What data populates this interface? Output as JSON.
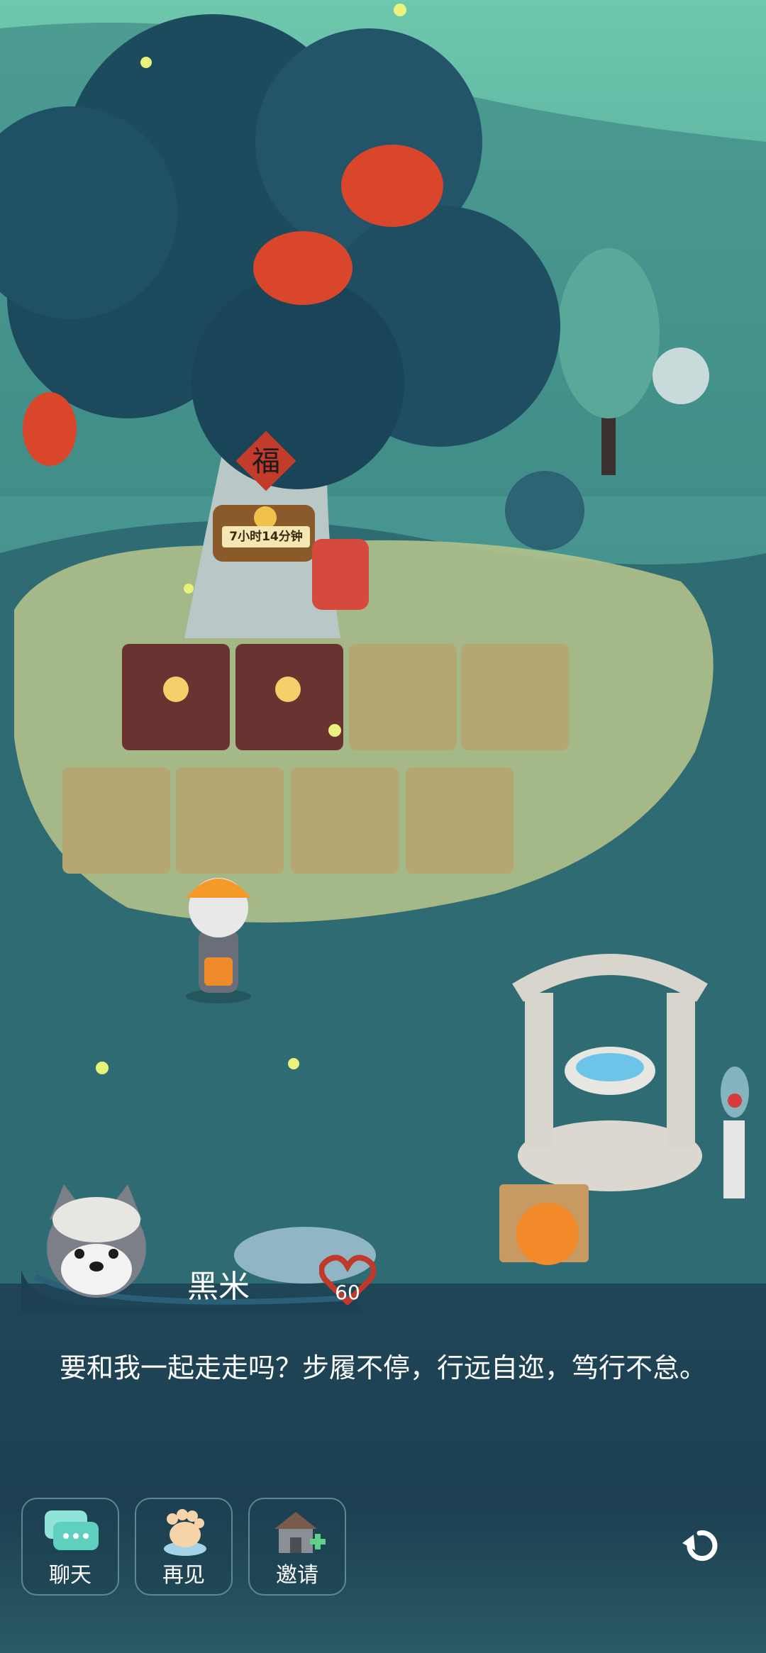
{
  "tree": {
    "sign_char": "福",
    "timer": "7小时14分钟"
  },
  "npc": {
    "name": "黑米",
    "affection": "60"
  },
  "dialog": {
    "text": "要和我一起走走吗？步履不停，行远自迩，笃行不怠。"
  },
  "actions": [
    {
      "label": "聊天",
      "icon": "chat-icon"
    },
    {
      "label": "再见",
      "icon": "paw-icon"
    },
    {
      "label": "邀请",
      "icon": "invite-house-icon"
    }
  ],
  "colors": {
    "dialog_bg": "#1f4556",
    "heart": "#c0392b",
    "lantern": "#d9462c",
    "soil_tilled": "#6a3230"
  }
}
